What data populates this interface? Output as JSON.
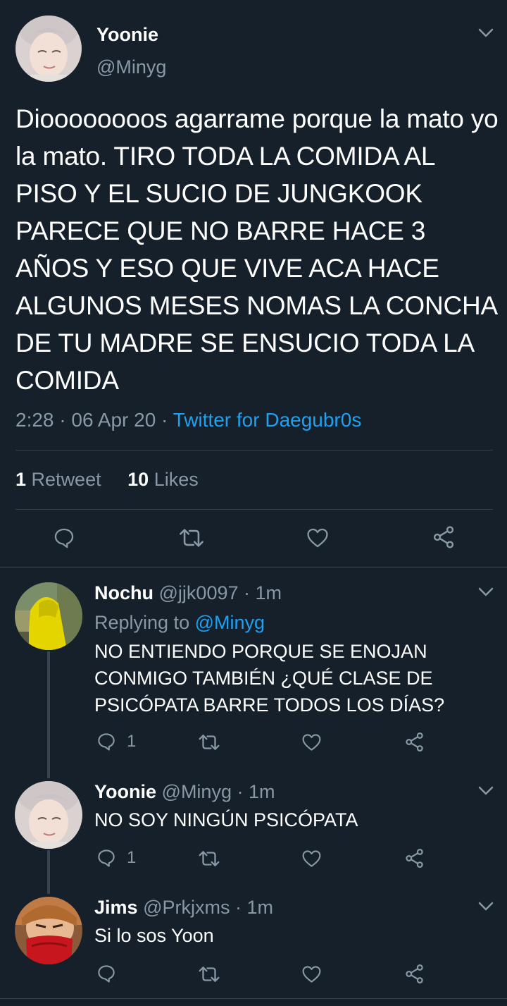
{
  "tweet": {
    "name": "Yoonie",
    "handle": "@Minyg",
    "text": "Dioooooooos agarrame porque la mato yo la mato. TIRO TODA LA COMIDA AL PISO Y EL SUCIO DE JUNGKOOK PARECE QUE NO BARRE HACE 3 AÑOS Y ESO QUE VIVE ACA HACE ALGUNOS MESES NOMAS LA CONCHA DE TU MADRE SE ENSUCIO TODA LA COMIDA",
    "time": "2:28",
    "date": "06 Apr 20",
    "source": "Twitter for Daegubr0s",
    "retweets": "1",
    "retweets_label": "Retweet",
    "likes": "10",
    "likes_label": "Likes"
  },
  "replies": [
    {
      "name": "Nochu",
      "handle": "@jjk0097",
      "time": "1m",
      "replying_label": "Replying to",
      "replying_to": "@Minyg",
      "text": "NO ENTIENDO PORQUE SE ENOJAN CONMIGO TAMBIÉN ¿QUÉ CLASE DE PSICÓPATA BARRE TODOS LOS DÍAS?",
      "reply_count": "1"
    },
    {
      "name": "Yoonie",
      "handle": "@Minyg",
      "time": "1m",
      "text": "NO SOY NINGÚN PSICÓPATA",
      "reply_count": "1"
    },
    {
      "name": "Jims",
      "handle": "@Prkjxms",
      "time": "1m",
      "text": "Si lo sos Yoon"
    }
  ],
  "separator": "·",
  "colors": {
    "background": "#15202b",
    "muted": "#8899a6",
    "link": "#1da1f2",
    "divider": "#38444d"
  }
}
